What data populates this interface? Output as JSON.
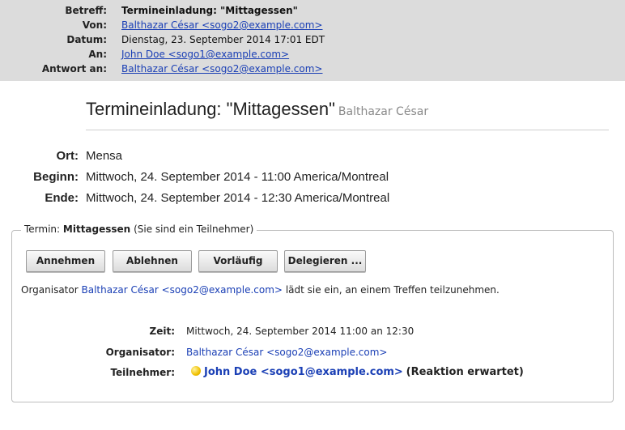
{
  "header": {
    "subject_label": "Betreff:",
    "subject": "Termineinladung: \"Mittagessen\"",
    "from_label": "Von:",
    "from": "Balthazar César <sogo2@example.com>",
    "date_label": "Datum:",
    "date": "Dienstag, 23. September 2014 17:01 EDT",
    "to_label": "An:",
    "to": "John Doe <sogo1@example.com>",
    "reply_label": "Antwort an:",
    "reply_to": "Balthazar César <sogo2@example.com>"
  },
  "event": {
    "title": "Termineinladung: \"Mittagessen\"",
    "organizer_name": "Balthazar César",
    "location_label": "Ort:",
    "location": "Mensa",
    "start_label": "Beginn:",
    "start": "Mittwoch, 24. September 2014 - 11:00 America/Montreal",
    "end_label": "Ende:",
    "end": "Mittwoch, 24. September 2014 - 12:30 America/Montreal"
  },
  "invitation": {
    "legend_prefix": "Termin:",
    "legend_name": "Mittagessen",
    "legend_suffix": "(Sie sind ein Teilnehmer)",
    "buttons": {
      "accept": "Annehmen",
      "decline": "Ablehnen",
      "tentative": "Vorläufig",
      "delegate": "Delegieren ..."
    },
    "message_prefix": "Organisator",
    "message_organizer": "Balthazar César <sogo2@example.com>",
    "message_suffix": "lädt sie ein, an einem Treffen teilzunehmen.",
    "time_label": "Zeit:",
    "time": "Mittwoch, 24. September 2014 11:00 an 12:30",
    "organizer_label": "Organisator:",
    "organizer": "Balthazar César <sogo2@example.com>",
    "attendees_label": "Teilnehmer:",
    "attendee": "John Doe <sogo1@example.com>",
    "attendee_status": "(Reaktion erwartet)",
    "attendee_status_icon": "yellow-circle-icon",
    "status_color": "#f0c000"
  }
}
